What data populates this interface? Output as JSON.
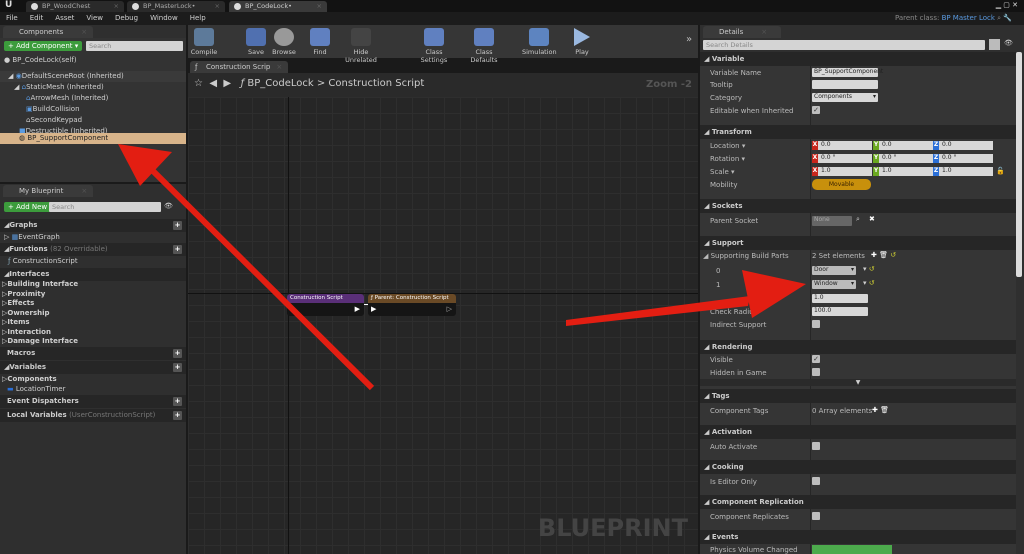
{
  "tabs": [
    "BP_WoodChest",
    "BP_MasterLock•",
    "BP_CodeLock•"
  ],
  "menu": [
    "File",
    "Edit",
    "Asset",
    "View",
    "Debug",
    "Window",
    "Help"
  ],
  "parent_class": {
    "label": "Parent class:",
    "value": "BP Master Lock"
  },
  "components": {
    "tab": "Components",
    "add": "+ Add Component ▾",
    "search": "Search",
    "self": "BP_CodeLock(self)",
    "tree": [
      "DefaultSceneRoot (Inherited)",
      "StaticMesh (Inherited)",
      "ArrowMesh (Inherited)",
      "BuildCollision",
      "SecondKeypad",
      "Destructible (Inherited)",
      "BP_SupportComponent"
    ]
  },
  "my_blueprint": {
    "tab": "My Blueprint",
    "add": "+ Add New ▾",
    "search": "Search",
    "graphs": "Graphs",
    "event_graph": "EventGraph",
    "functions": "Functions",
    "functions_note": "(82 Overridable)",
    "construction": "ConstructionScript",
    "interfaces": "Interfaces",
    "interface_items": [
      "Building Interface",
      "Proximity",
      "Effects",
      "Ownership",
      "Items",
      "Interaction",
      "Damage Interface"
    ],
    "macros": "Macros",
    "variables": "Variables",
    "comp": "Components",
    "location_timer": "LocationTimer",
    "dispatchers": "Event Dispatchers",
    "local_vars": "Local Variables",
    "local_note": "(UserConstructionScript)"
  },
  "toolbar": [
    "Compile",
    "Save",
    "Browse",
    "Find",
    "Hide Unrelated",
    "Class Settings",
    "Class Defaults",
    "Simulation",
    "Play"
  ],
  "graph": {
    "tab": "Construction Scrip",
    "crumb_bp": "BP_CodeLock",
    "crumb_sep": ">",
    "crumb_fn": "Construction Script",
    "zoom": "Zoom -2",
    "watermark": "BLUEPRINT",
    "node1": "Construction Script",
    "node2": "Parent: Construction Script"
  },
  "details": {
    "tab": "Details",
    "search": "Search Details",
    "variable": {
      "title": "Variable",
      "name_label": "Variable Name",
      "name": "BP_SupportComponent",
      "tooltip": "Tooltip",
      "category_label": "Category",
      "category": "Components",
      "editable": "Editable when Inherited"
    },
    "transform": {
      "title": "Transform",
      "location": "Location ▾",
      "rotation": "Rotation ▾",
      "scale": "Scale ▾",
      "mobility": "Mobility",
      "movable": "Movable",
      "loc": [
        "0.0",
        "0.0",
        "0.0"
      ],
      "rot": [
        "0.0 °",
        "0.0 °",
        "0.0 °"
      ],
      "scl": [
        "1.0",
        "1.0",
        "1.0"
      ]
    },
    "sockets": {
      "title": "Sockets",
      "parent": "Parent Socket",
      "none": "None"
    },
    "support": {
      "title": "Support",
      "parts": "Supporting Build Parts",
      "count": "2 Set elements",
      "i0": "0",
      "v0": "Door",
      "i1": "1",
      "v1": "Window",
      "hidden_val": "1.0",
      "radius": "Check Radius",
      "radius_val": "100.0",
      "indirect": "Indirect Support"
    },
    "rendering": {
      "title": "Rendering",
      "visible": "Visible",
      "hidden": "Hidden in Game"
    },
    "tags": {
      "title": "Tags",
      "comp": "Component Tags",
      "count": "0 Array elements"
    },
    "activation": {
      "title": "Activation",
      "auto": "Auto Activate"
    },
    "cooking": {
      "title": "Cooking",
      "editor": "Is Editor Only"
    },
    "replication": {
      "title": "Component Replication",
      "rep": "Component Replicates"
    },
    "events": {
      "title": "Events",
      "physics": "Physics Volume Changed"
    }
  }
}
